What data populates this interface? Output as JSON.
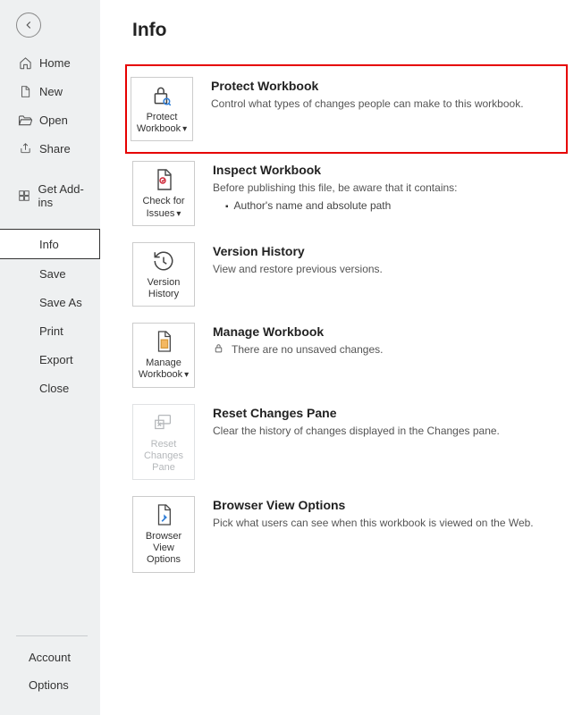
{
  "page_title": "Info",
  "sidebar": {
    "items": [
      {
        "label": "Home"
      },
      {
        "label": "New"
      },
      {
        "label": "Open"
      },
      {
        "label": "Share"
      }
    ],
    "addins_label": "Get Add-ins",
    "file_items": [
      {
        "label": "Info"
      },
      {
        "label": "Save"
      },
      {
        "label": "Save As"
      },
      {
        "label": "Print"
      },
      {
        "label": "Export"
      },
      {
        "label": "Close"
      }
    ],
    "bottom_items": [
      {
        "label": "Account"
      },
      {
        "label": "Options"
      }
    ]
  },
  "sections": {
    "protect": {
      "tile_label": "Protect Workbook",
      "heading": "Protect Workbook",
      "text": "Control what types of changes people can make to this workbook."
    },
    "inspect": {
      "tile_label": "Check for Issues",
      "heading": "Inspect Workbook",
      "lead": "Before publishing this file, be aware that it contains:",
      "bullet1": "Author's name and absolute path"
    },
    "history": {
      "tile_label": "Version History",
      "heading": "Version History",
      "text": "View and restore previous versions."
    },
    "manage": {
      "tile_label": "Manage Workbook",
      "heading": "Manage Workbook",
      "text": "There are no unsaved changes."
    },
    "reset": {
      "tile_label": "Reset Changes Pane",
      "heading": "Reset Changes Pane",
      "text": "Clear the history of changes displayed in the Changes pane."
    },
    "browser": {
      "tile_label": "Browser View Options",
      "heading": "Browser View Options",
      "text": "Pick what users can see when this workbook is viewed on the Web."
    }
  }
}
